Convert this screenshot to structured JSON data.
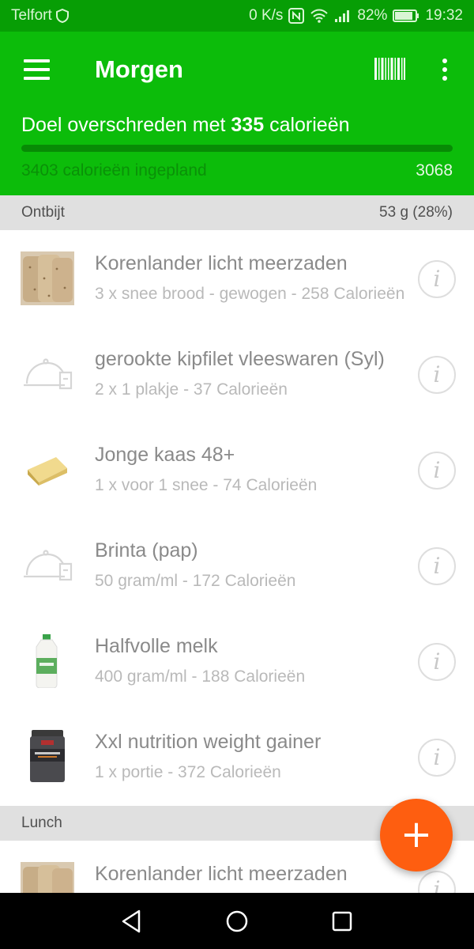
{
  "status_bar": {
    "carrier": "Telfort",
    "network_speed": "0 K/s",
    "battery": "82%",
    "time": "19:32"
  },
  "header": {
    "title": "Morgen",
    "goal_prefix": "Doel overschreden met ",
    "goal_amount": "335",
    "goal_suffix": " calorieën",
    "planned": "3403 calorieën ingepland",
    "total": "3068",
    "progress_fraction": 1.0
  },
  "sections": [
    {
      "name": "Ontbijt",
      "value": "53 g (28%)"
    },
    {
      "name": "Lunch",
      "value": ""
    }
  ],
  "breakfast_items": [
    {
      "name": "Korenlander licht meerzaden",
      "desc": "3 x snee brood - gewogen - 258 Calorieën",
      "icon": "bread-photo"
    },
    {
      "name": "gerookte kipfilet vleeswaren (Syl)",
      "desc": "2 x 1 plakje - 37 Calorieën",
      "icon": "meal-placeholder-icon"
    },
    {
      "name": "Jonge kaas 48+",
      "desc": "1 x voor 1 snee - 74 Calorieën",
      "icon": "cheese-photo"
    },
    {
      "name": "Brinta (pap)",
      "desc": "50 gram/ml - 172 Calorieën",
      "icon": "meal-placeholder-icon"
    },
    {
      "name": "Halfvolle melk",
      "desc": "400 gram/ml - 188 Calorieën",
      "icon": "milk-photo"
    },
    {
      "name": "Xxl nutrition weight gainer",
      "desc": "1 x portie - 372 Calorieën",
      "icon": "supplement-tub-photo"
    }
  ],
  "lunch_items": [
    {
      "name": "Korenlander licht meerzaden",
      "icon": "bread-photo"
    }
  ],
  "info_glyph": "i",
  "fab_glyph": "+",
  "colors": {
    "primary": "#0cbc0a",
    "status_bar": "#079e05",
    "progress": "#078b05",
    "accent": "#fe5e10"
  }
}
